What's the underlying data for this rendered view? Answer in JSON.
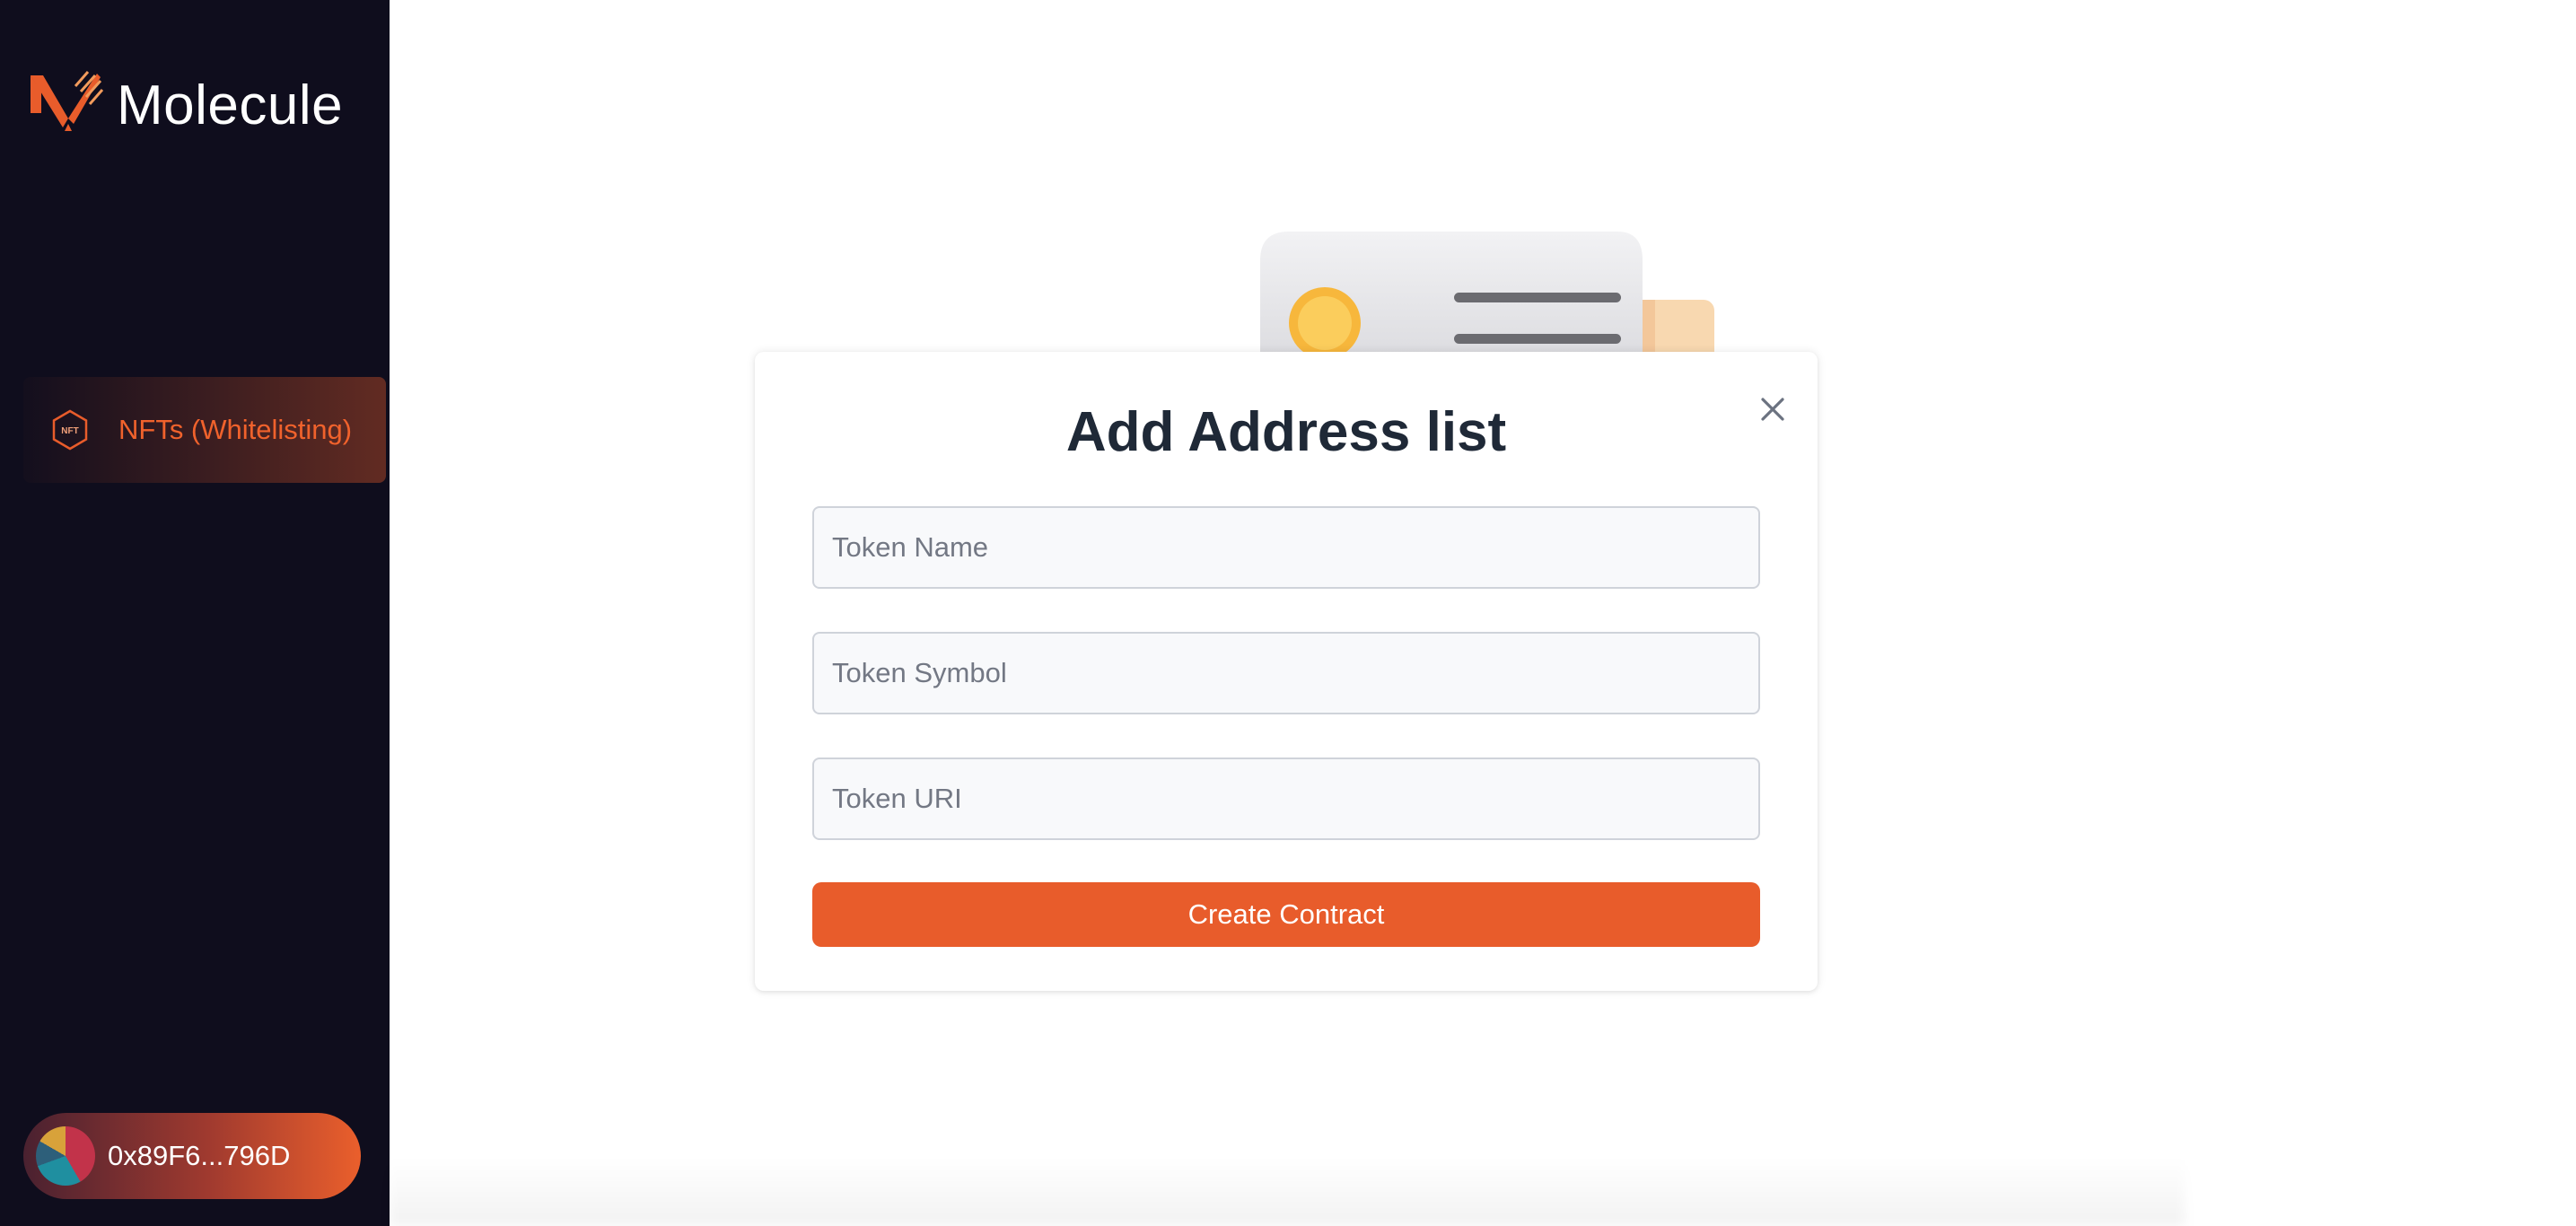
{
  "sidebar": {
    "brand": "Molecule",
    "nav": [
      {
        "label": "NFTs (Whitelisting)",
        "icon": "nft-hexagon-icon",
        "icon_text": "NFT",
        "active": true
      }
    ],
    "wallet": {
      "address": "0x89F6...796D",
      "avatar": "wallet-avatar-icon"
    }
  },
  "modal": {
    "title": "Add Address list",
    "fields": [
      {
        "placeholder": "Token Name",
        "value": ""
      },
      {
        "placeholder": "Token Symbol",
        "value": ""
      },
      {
        "placeholder": "Token URI",
        "value": ""
      }
    ],
    "submit_label": "Create Contract",
    "close_icon": "close-icon"
  },
  "colors": {
    "sidebar_bg": "#0f0d1d",
    "accent": "#e85c2b",
    "title": "#1f2937"
  }
}
